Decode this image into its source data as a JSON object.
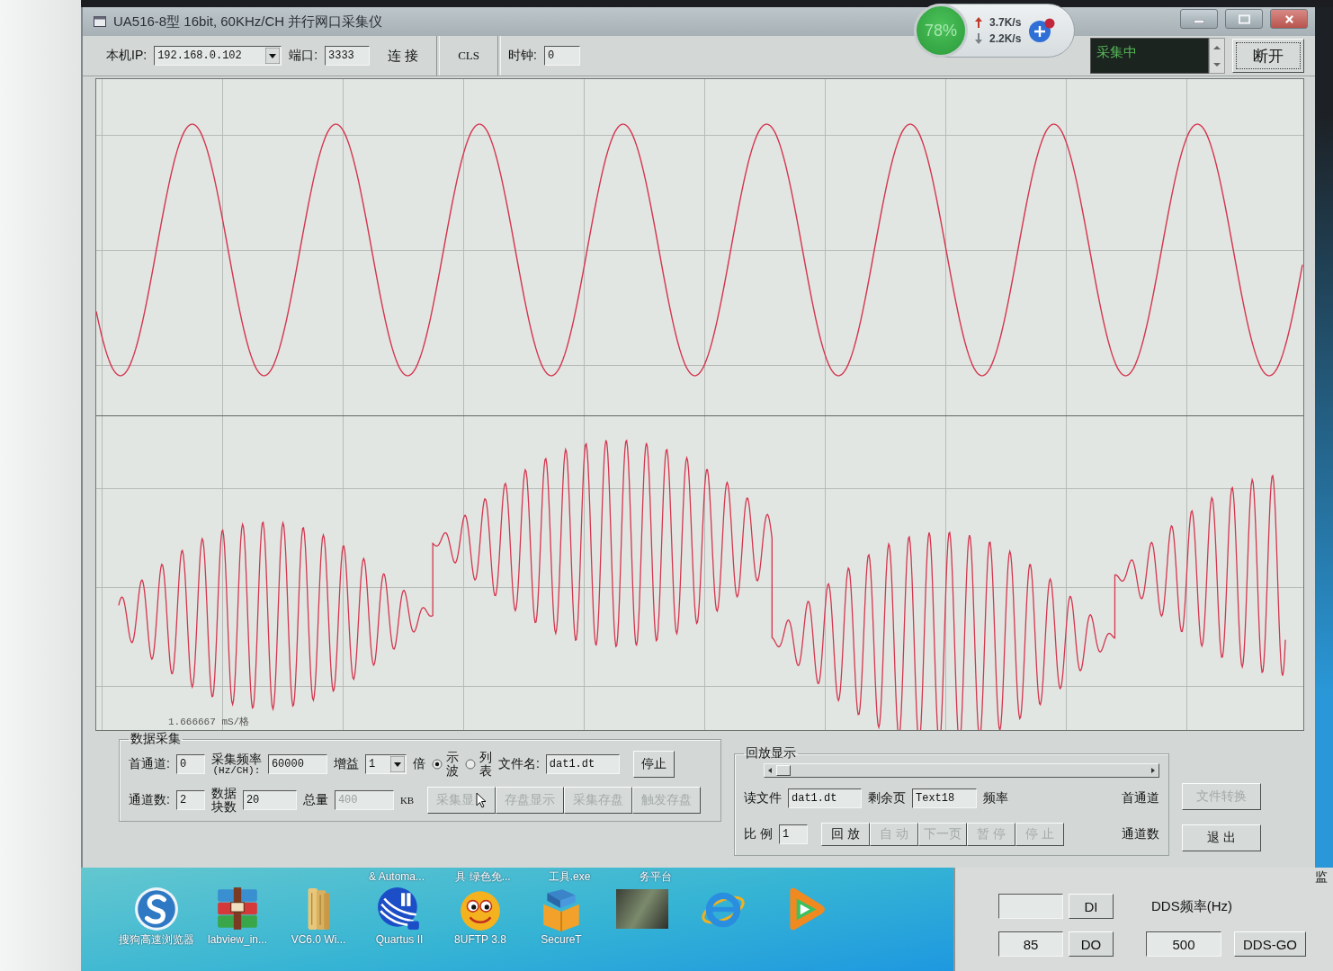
{
  "window": {
    "title": "UA516-8型 16bit, 60KHz/CH 并行网口采集仪"
  },
  "speed_widget": {
    "percent": "78%",
    "upload": "3.7K/s",
    "download": "2.2K/s"
  },
  "toolbar": {
    "ip_label": "本机IP:",
    "ip_value": "192.168.0.102",
    "port_label": "端口:",
    "port_value": "3333",
    "connect_button": "连 接",
    "cls_button": "CLS",
    "clock_label": "时钟:",
    "clock_value": "0",
    "status_text": "采集中",
    "disconnect_button": "断开"
  },
  "scope": {
    "scale_label": "1.666667 mS/格"
  },
  "acquisition": {
    "title": "数据采集",
    "first_channel_label": "首通道:",
    "first_channel_value": "0",
    "rate_label": "采集频率",
    "rate_unit": "(Hz/CH):",
    "rate_value": "60000",
    "gain_label": "增益",
    "gain_value": "1",
    "gain_unit": "倍",
    "display_modes": [
      {
        "label": "示波",
        "selected": true
      },
      {
        "label": "列表",
        "selected": false
      }
    ],
    "filename_label": "文件名:",
    "filename_value": "dat1.dt",
    "stop_button": "停止",
    "channel_count_label": "通道数:",
    "channel_count_value": "2",
    "blocks_label": "数据块数",
    "blocks_value": "20",
    "total_label": "总量",
    "total_value": "400",
    "total_unit": "KB",
    "actions": [
      {
        "label": "采集显",
        "disabled": true
      },
      {
        "label": "存盘显示",
        "disabled": true
      },
      {
        "label": "采集存盘",
        "disabled": true
      },
      {
        "label": "触发存盘",
        "disabled": true
      }
    ]
  },
  "playback": {
    "title": "回放显示",
    "read_file_label": "读文件",
    "read_file_value": "dat1.dt",
    "pages_left_label": "剩余页",
    "pages_left_value": "Text18",
    "frequency_label": "频率",
    "first_channel_label": "首通道",
    "scale_label": "比 例",
    "scale_value": "1",
    "controls": [
      {
        "label": "回 放",
        "disabled": false
      },
      {
        "label": "自 动",
        "disabled": true
      },
      {
        "label": "下一页",
        "disabled": true
      },
      {
        "label": "暂 停",
        "disabled": true
      },
      {
        "label": "停 止",
        "disabled": true
      }
    ],
    "channel_count_label": "通道数"
  },
  "side_buttons": [
    {
      "label": "文件转换",
      "disabled": true
    },
    {
      "label": "退 出",
      "disabled": false
    }
  ],
  "desktop": {
    "top_labels": [
      "& Automa...",
      "具 绿色免...",
      "工具.exe",
      "务平台"
    ],
    "icons": [
      {
        "kind": "sogou",
        "label": "搜狗高速浏览器"
      },
      {
        "kind": "archive",
        "label": "labview_in..."
      },
      {
        "kind": "books",
        "label": "VC6.0 Wi..."
      },
      {
        "kind": "quartus",
        "label": "Quartus II"
      },
      {
        "kind": "smiley",
        "label": "8UFTP 3.8"
      },
      {
        "kind": "box",
        "label": "SecureT"
      },
      {
        "kind": "photo"
      },
      {
        "kind": "browser"
      },
      {
        "kind": "video"
      }
    ]
  },
  "io_window": {
    "cut_label": "监",
    "di_button": "DI",
    "dds_label": "DDS频率(Hz)",
    "do_value": "85",
    "do_button": "DO",
    "dds_value": "500",
    "dds_button": "DDS-GO"
  }
}
